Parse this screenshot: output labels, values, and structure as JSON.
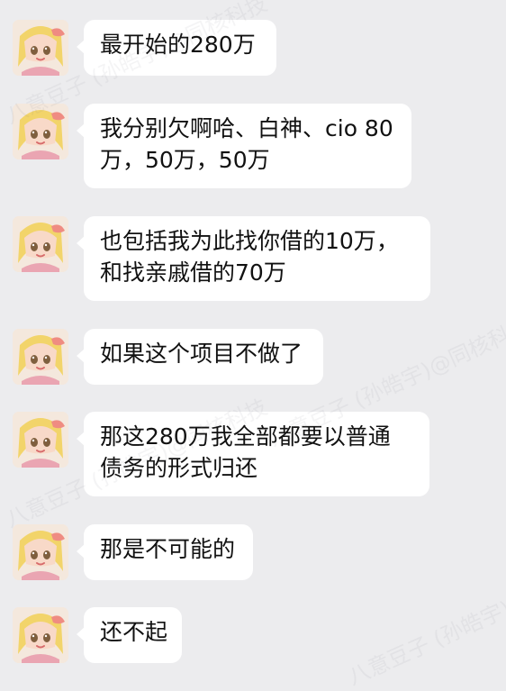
{
  "watermark": {
    "text": "八意豆子 (孙皓宇)@同核科技"
  },
  "messages": [
    {
      "avatar_icon": "anime-girl-avatar-icon",
      "lines": [
        "最开始的280万"
      ]
    },
    {
      "avatar_icon": "anime-girl-avatar-icon",
      "lines": [
        "我分别欠啊哈、白神、cio 80",
        "万，50万，50万"
      ]
    },
    {
      "avatar_icon": "anime-girl-avatar-icon",
      "lines": [
        "也包括我为此找你借的10万，",
        "和找亲戚借的70万"
      ]
    },
    {
      "avatar_icon": "anime-girl-avatar-icon",
      "lines": [
        "如果这个项目不做了"
      ]
    },
    {
      "avatar_icon": "anime-girl-avatar-icon",
      "lines": [
        "那这280万我全部都要以普通",
        "债务的形式归还"
      ]
    },
    {
      "avatar_icon": "anime-girl-avatar-icon",
      "lines": [
        "那是不可能的"
      ]
    },
    {
      "avatar_icon": "anime-girl-avatar-icon",
      "lines": [
        "还不起"
      ]
    }
  ]
}
